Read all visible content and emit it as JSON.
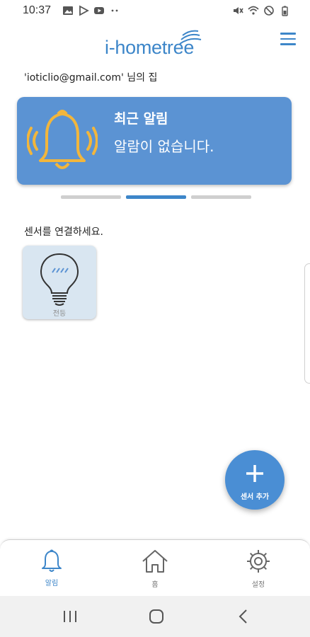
{
  "status_bar": {
    "time": "10:37",
    "left_icons": [
      "gallery-icon",
      "play-store-icon",
      "youtube-icon",
      "more-dots-icon"
    ],
    "right_icons": [
      "mute-icon",
      "wifi-icon",
      "do-not-disturb-icon",
      "battery-icon"
    ]
  },
  "header": {
    "logo_text": "i-hometree",
    "menu_icon": "hamburger-menu-icon"
  },
  "home_owner": "'ioticlio@gmail.com' 님의 집",
  "alert_card": {
    "icon": "bell-ringing-icon",
    "title": "최근 알림",
    "message": "알람이 없습니다."
  },
  "pager": {
    "count": 3,
    "active_index": 1
  },
  "connect_label": "센서를 연결하세요.",
  "sensors": [
    {
      "icon": "light-bulb-icon",
      "label": "전등"
    }
  ],
  "fab": {
    "icon": "plus-icon",
    "label": "센서 추가"
  },
  "bottom_nav": {
    "items": [
      {
        "label": "알림",
        "icon": "bell-icon",
        "active": true
      },
      {
        "label": "홈",
        "icon": "home-icon",
        "active": false
      },
      {
        "label": "설정",
        "icon": "gear-icon",
        "active": false
      }
    ]
  },
  "colors": {
    "accent": "#3d86c9",
    "card_bg": "#5b93d3",
    "bell": "#f2b63c",
    "sensor_tile_bg": "#d9e6f1",
    "fab_bg": "#4a8ed4"
  }
}
